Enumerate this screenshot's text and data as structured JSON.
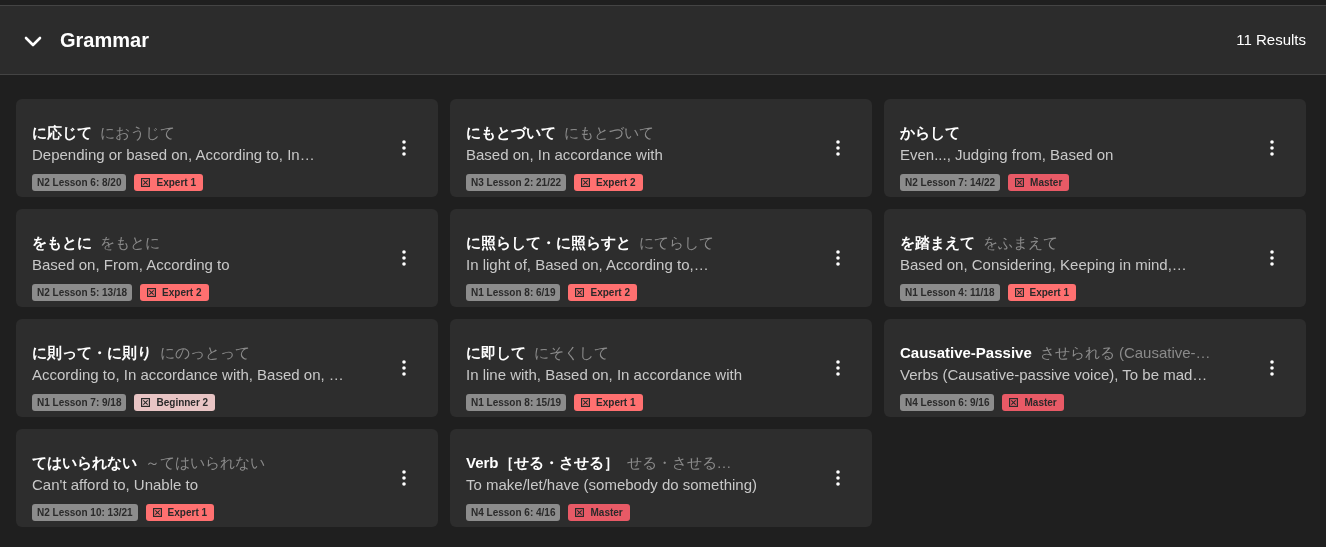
{
  "section": {
    "title": "Grammar",
    "expanded": true,
    "count": "11 Results"
  },
  "cards": [
    {
      "title": "に応じて",
      "reading": "におうじて",
      "meaning": "Depending or based on, According to, In…",
      "lesson": "N2 Lesson 6: 8/20",
      "level": "Expert 1",
      "color": "#ff7070"
    },
    {
      "title": "にもとづいて",
      "reading": "にもとづいて",
      "meaning": "Based on, In accordance with",
      "lesson": "N3 Lesson 2: 21/22",
      "level": "Expert 2",
      "color": "#ff7070"
    },
    {
      "title": "からして",
      "meaning": "Even..., Judging from, Based on",
      "lesson": "N2 Lesson 7: 14/22",
      "level": "Master",
      "color": "#e85a66"
    },
    {
      "title": "をもとに",
      "reading": "をもとに",
      "meaning": "Based on, From, According to",
      "lesson": "N2 Lesson 5: 13/18",
      "level": "Expert 2",
      "color": "#ff7070"
    },
    {
      "title": "に照らして・に照らすと",
      "reading": "にてらして",
      "meaning": "In light of, Based on, According to,…",
      "lesson": "N1 Lesson 8: 6/19",
      "level": "Expert 2",
      "color": "#ff7070"
    },
    {
      "title": "を踏まえて",
      "reading": "をふまえて",
      "meaning": "Based on, Considering, Keeping in mind,…",
      "lesson": "N1 Lesson 4: 11/18",
      "level": "Expert 1",
      "color": "#ff7070"
    },
    {
      "title": "に則って・に則り",
      "reading": "にのっとって",
      "meaning": "According to, In accordance with, Based on, …",
      "lesson": "N1 Lesson 7: 9/18",
      "level": "Beginner 2",
      "color": "#e8c4c4"
    },
    {
      "title": "に即して",
      "reading": "にそくして",
      "meaning": "In line with, Based on, In accordance with",
      "lesson": "N1 Lesson 8: 15/19",
      "level": "Expert 1",
      "color": "#ff7070"
    },
    {
      "title": "Causative-Passive",
      "reading": "させられる (Causative-…",
      "meaning": "Verbs (Causative-passive voice), To be mad…",
      "lesson": "N4 Lesson 6: 9/16",
      "level": "Master",
      "color": "#e85a66"
    },
    {
      "title": "てはいられない",
      "reading": "～てはいられない",
      "meaning": "Can't afford to, Unable to",
      "lesson": "N2 Lesson 10: 13/21",
      "level": "Expert 1",
      "color": "#ff7070"
    },
    {
      "title": "Verb［せる・させる］",
      "reading": "せる・させる…",
      "meaning": "To make/let/have (somebody do something)",
      "lesson": "N4 Lesson 6: 4/16",
      "level": "Master",
      "color": "#e85a66"
    }
  ]
}
